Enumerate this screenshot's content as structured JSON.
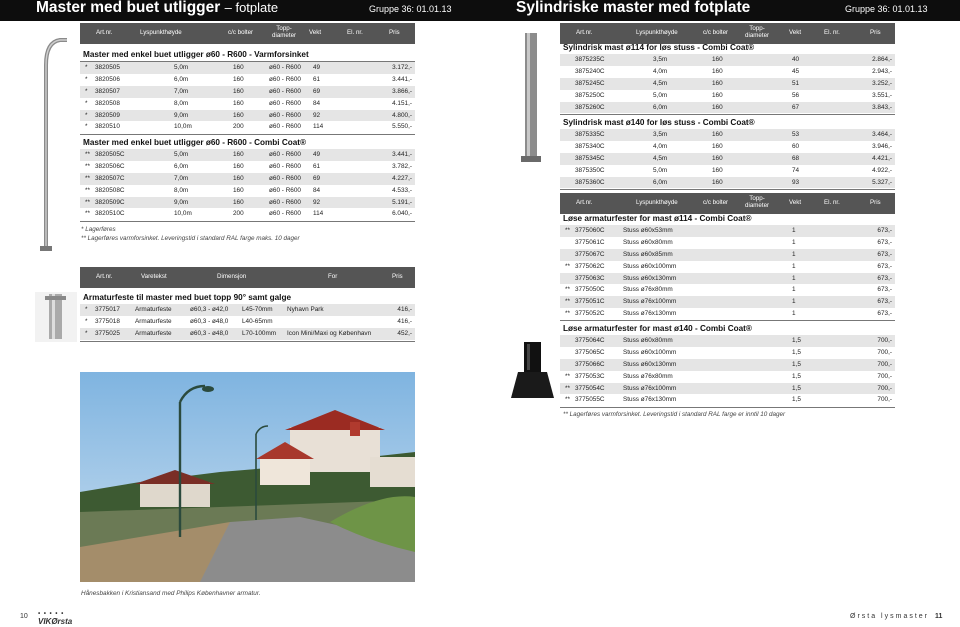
{
  "left": {
    "banner": {
      "title": "Master med buet utligger",
      "subtitle": "– fotplate",
      "group": "Gruppe 36: 01.01.13"
    },
    "cols": [
      "Art.nr.",
      "Lyspunkthøyde",
      "c/c bolter",
      "Topp-\ndiameter",
      "Vekt",
      "El. nr.",
      "Pris"
    ],
    "sections": [
      {
        "title": "Master med enkel buet utligger ø60 - R600 - Varmforsinket",
        "rows": [
          [
            "*",
            "3820505",
            "5,0m",
            "160",
            "ø60 - R600",
            "49",
            "3.172,-"
          ],
          [
            "*",
            "3820506",
            "6,0m",
            "160",
            "ø60 - R600",
            "61",
            "3.441,-"
          ],
          [
            "*",
            "3820507",
            "7,0m",
            "160",
            "ø60 - R600",
            "69",
            "3.866,-"
          ],
          [
            "*",
            "3820508",
            "8,0m",
            "160",
            "ø60 - R600",
            "84",
            "4.151,-"
          ],
          [
            "*",
            "3820509",
            "9,0m",
            "160",
            "ø60 - R600",
            "92",
            "4.800,-"
          ],
          [
            "*",
            "3820510",
            "10,0m",
            "200",
            "ø60 - R600",
            "114",
            "5.550,-"
          ]
        ]
      },
      {
        "title": "Master med enkel buet utligger ø60 - R600 - Combi Coat®",
        "rows": [
          [
            "**",
            "3820505C",
            "5,0m",
            "160",
            "ø60 - R600",
            "49",
            "3.441,-"
          ],
          [
            "**",
            "3820506C",
            "6,0m",
            "160",
            "ø60 - R600",
            "61",
            "3.782,-"
          ],
          [
            "**",
            "3820507C",
            "7,0m",
            "160",
            "ø60 - R600",
            "69",
            "4.227,-"
          ],
          [
            "**",
            "3820508C",
            "8,0m",
            "160",
            "ø60 - R600",
            "84",
            "4.533,-"
          ],
          [
            "**",
            "3820509C",
            "9,0m",
            "160",
            "ø60 - R600",
            "92",
            "5.191,-"
          ],
          [
            "**",
            "3820510C",
            "10,0m",
            "200",
            "ø60 - R600",
            "114",
            "6.040,-"
          ]
        ]
      }
    ],
    "notes": [
      "* Lagerføres",
      "** Lagerføres varmforsinket. Leveringstid i standard RAL farge maks. 10 dager"
    ],
    "cols2": [
      "Art.nr.",
      "Varetekst",
      "Dimensjon",
      "For",
      "Pris"
    ],
    "section2": {
      "title": "Armaturfeste til master med buet topp 90° samt galge",
      "rows": [
        [
          "*",
          "3775017",
          "Armaturfeste",
          "ø60,3 - ø42,0",
          "L45-70mm",
          "Nyhavn Park",
          "416,-"
        ],
        [
          "*",
          "3775018",
          "Armaturfeste",
          "ø60,3 - ø48,0",
          "L40-65mm",
          "",
          "416,-"
        ],
        [
          "*",
          "3775025",
          "Armaturfeste",
          "ø60,3 - ø48,0",
          "L70-100mm",
          "Icon Mini/Maxi og København",
          "452,-"
        ]
      ]
    },
    "caption": "Hånesbakken i Kristiansand med Philips Københavner armatur.",
    "page_number": "10",
    "logo": "VIKØrsta"
  },
  "right": {
    "banner": {
      "title": "Sylindriske master med fotplate",
      "group": "Gruppe 36: 01.01.13"
    },
    "cols": [
      "Art.nr.",
      "Lyspunkthøyde",
      "c/c bolter",
      "Topp-\ndiameter",
      "Vekt",
      "El. nr.",
      "Pris"
    ],
    "sections": [
      {
        "title": "Sylindrisk mast ø114 for løs stuss - Combi Coat®",
        "rows": [
          [
            "",
            "3875235C",
            "3,5m",
            "160",
            "",
            "40",
            "2.864,-"
          ],
          [
            "",
            "3875240C",
            "4,0m",
            "160",
            "",
            "45",
            "2.943,-"
          ],
          [
            "",
            "3875245C",
            "4,5m",
            "160",
            "",
            "51",
            "3.252,-"
          ],
          [
            "",
            "3875250C",
            "5,0m",
            "160",
            "",
            "56",
            "3.551,-"
          ],
          [
            "",
            "3875260C",
            "6,0m",
            "160",
            "",
            "67",
            "3.843,-"
          ]
        ]
      },
      {
        "title": "Sylindrisk mast ø140 for løs stuss - Combi Coat®",
        "rows": [
          [
            "",
            "3875335C",
            "3,5m",
            "160",
            "",
            "53",
            "3.464,-"
          ],
          [
            "",
            "3875340C",
            "4,0m",
            "160",
            "",
            "60",
            "3.946,-"
          ],
          [
            "",
            "3875345C",
            "4,5m",
            "160",
            "",
            "68",
            "4.421,-"
          ],
          [
            "",
            "3875350C",
            "5,0m",
            "160",
            "",
            "74",
            "4.922,-"
          ],
          [
            "",
            "3875360C",
            "6,0m",
            "160",
            "",
            "93",
            "5.327,-"
          ]
        ]
      }
    ],
    "cols2": [
      "Art.nr.",
      "Lyspunkthøyde",
      "c/c bolter",
      "Topp-\ndiameter",
      "Vekt",
      "El. nr.",
      "Pris"
    ],
    "sections2": [
      {
        "title": "Løse armaturfester for mast ø114 - Combi Coat®",
        "rows": [
          [
            "**",
            "3775060C",
            "Stuss ø60x53mm",
            "1",
            "673,-"
          ],
          [
            "",
            "3775061C",
            "Stuss ø60x80mm",
            "1",
            "673,-"
          ],
          [
            "",
            "3775067C",
            "Stuss ø60x85mm",
            "1",
            "673,-"
          ],
          [
            "**",
            "3775062C",
            "Stuss ø60x100mm",
            "1",
            "673,-"
          ],
          [
            "",
            "3775063C",
            "Stuss ø60x130mm",
            "1",
            "673,-"
          ],
          [
            "**",
            "3775050C",
            "Stuss ø76x80mm",
            "1",
            "673,-"
          ],
          [
            "**",
            "3775051C",
            "Stuss ø76x100mm",
            "1",
            "673,-"
          ],
          [
            "**",
            "3775052C",
            "Stuss ø76x130mm",
            "1",
            "673,-"
          ]
        ]
      },
      {
        "title": "Løse armaturfester for mast ø140 - Combi Coat®",
        "rows": [
          [
            "",
            "3775064C",
            "Stuss ø60x80mm",
            "1,5",
            "700,-"
          ],
          [
            "",
            "3775065C",
            "Stuss ø60x100mm",
            "1,5",
            "700,-"
          ],
          [
            "",
            "3775066C",
            "Stuss ø60x130mm",
            "1,5",
            "700,-"
          ],
          [
            "**",
            "3775053C",
            "Stuss ø76x80mm",
            "1,5",
            "700,-"
          ],
          [
            "**",
            "3775054C",
            "Stuss ø76x100mm",
            "1,5",
            "700,-"
          ],
          [
            "**",
            "3775055C",
            "Stuss ø76x130mm",
            "1,5",
            "700,-"
          ]
        ]
      }
    ],
    "note": "** Lagerføres varmforsinket. Leveringstid i standard RAL farge er inntil 10 dager",
    "footer_brand": "Ørsta lysmaster",
    "page_number": "11"
  }
}
